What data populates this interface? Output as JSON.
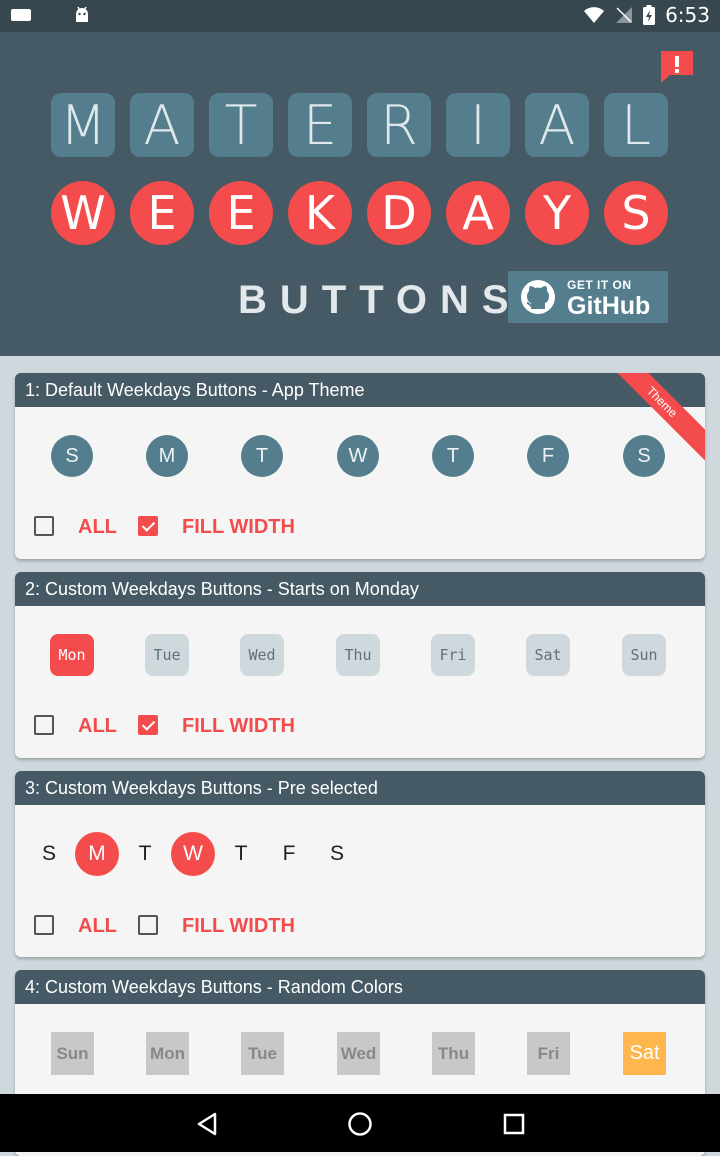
{
  "status_bar": {
    "time": "6:53"
  },
  "header": {
    "title_top": [
      "M",
      "A",
      "T",
      "E",
      "R",
      "I",
      "A",
      "L"
    ],
    "title_bottom": [
      "W",
      "E",
      "E",
      "K",
      "D",
      "A",
      "Y",
      "S"
    ],
    "subtitle": "BUTTONS",
    "github_badge": {
      "small": "GET IT ON",
      "big": "GitHub"
    }
  },
  "cards": [
    {
      "title": "1: Default Weekdays Buttons - App Theme",
      "ribbon": "Theme",
      "days": [
        "S",
        "M",
        "T",
        "W",
        "T",
        "F",
        "S"
      ],
      "all_label": "ALL",
      "all_checked": false,
      "fill_label": "FILL WIDTH",
      "fill_checked": true
    },
    {
      "title": "2: Custom Weekdays Buttons - Starts on Monday",
      "days": [
        "Mon",
        "Tue",
        "Wed",
        "Thu",
        "Fri",
        "Sat",
        "Sun"
      ],
      "selected": [
        "Mon"
      ],
      "all_label": "ALL",
      "all_checked": false,
      "fill_label": "FILL WIDTH",
      "fill_checked": true
    },
    {
      "title": "3: Custom Weekdays Buttons - Pre selected",
      "days": [
        "S",
        "M",
        "T",
        "W",
        "T",
        "F",
        "S"
      ],
      "selected_indices": [
        1,
        3
      ],
      "all_label": "ALL",
      "all_checked": false,
      "fill_label": "FILL WIDTH",
      "fill_checked": false
    },
    {
      "title": "4: Custom Weekdays Buttons - Random Colors",
      "days": [
        "Sun",
        "Mon",
        "Tue",
        "Wed",
        "Thu",
        "Fri",
        "Sat"
      ],
      "selected": [
        "Sat"
      ]
    }
  ],
  "colors": {
    "accent": "#f44c4c",
    "primary": "#455a64",
    "tile": "#547e8d",
    "orange": "#ffb74d"
  }
}
